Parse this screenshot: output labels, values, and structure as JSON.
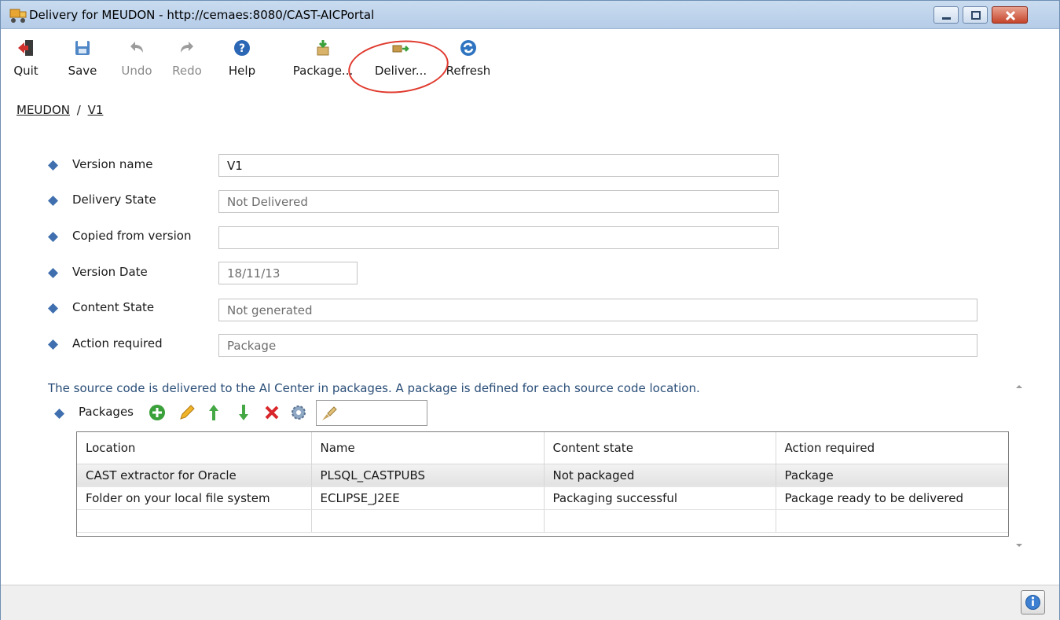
{
  "window": {
    "title": "Delivery for MEUDON - http://cemaes:8080/CAST-AICPortal"
  },
  "toolbar": {
    "quit_label": "Quit",
    "save_label": "Save",
    "undo_label": "Undo",
    "redo_label": "Redo",
    "help_label": "Help",
    "package_label": "Package...",
    "deliver_label": "Deliver...",
    "refresh_label": "Refresh"
  },
  "breadcrumb": {
    "app": "MEUDON",
    "separator": "/",
    "version": "V1"
  },
  "form": {
    "version_name_label": "Version name",
    "version_name_value": "V1",
    "delivery_state_label": "Delivery State",
    "delivery_state_value": "Not Delivered",
    "copied_from_label": "Copied from version",
    "copied_from_value": "",
    "version_date_label": "Version Date",
    "version_date_value": "18/11/13",
    "content_state_label": "Content State",
    "content_state_value": "Not generated",
    "action_required_label": "Action required",
    "action_required_value": "Package"
  },
  "packages": {
    "info": "The source code is delivered to the AI Center in packages. A package is defined for each source code location.",
    "label": "Packages",
    "filter_value": "",
    "columns": [
      "Location",
      "Name",
      "Content state",
      "Action required"
    ],
    "rows": [
      [
        "CAST extractor for Oracle",
        "PLSQL_CASTPUBS",
        "Not packaged",
        "Package"
      ],
      [
        "Folder on your local file system",
        "ECLIPSE_J2EE",
        "Packaging successful",
        "Package ready to be delivered"
      ],
      [
        "",
        "",
        "",
        ""
      ]
    ]
  },
  "colors": {
    "accent": "#2a4e78",
    "diamond": "#3f6fae",
    "highlight": "#e03a2e",
    "titlebar": "#b5cce8"
  }
}
